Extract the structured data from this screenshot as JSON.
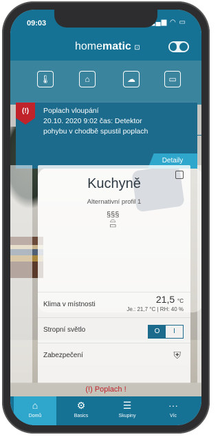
{
  "status": {
    "time": "09:03",
    "icons": "▂▄▆ ◠ ▭"
  },
  "header": {
    "brand_prefix": "home",
    "brand_suffix": "matic",
    "brand_mark": "⊡"
  },
  "quick_icons": [
    {
      "name": "thermometer-icon",
      "glyph": "🌡"
    },
    {
      "name": "home-icon",
      "glyph": "⌂"
    },
    {
      "name": "cloud-icon",
      "glyph": "☁"
    },
    {
      "name": "window-icon",
      "glyph": "▭"
    }
  ],
  "alarm": {
    "title": "Poplach vloupání",
    "line1": "20.10. 2020 9:02 čas: Detektor",
    "line2": "pohybu v chodbě spustil poplach",
    "details_label": "Detaily",
    "flag_glyph": "(!)"
  },
  "card": {
    "title": "Kuchyně",
    "subtitle": "Alternativní profil 1",
    "rows": {
      "climate_label": "Klima v místnosti",
      "climate_value": "21,5",
      "climate_unit": "°C",
      "climate_sub": "Je.: 21,7 °C | RH: 40 %",
      "light_label": "Stropní světlo",
      "light_on": "O",
      "light_off": "I",
      "security_label": "Zabezpečení"
    }
  },
  "alarm_bar": {
    "glyph": "(!)",
    "label": "Poplach !"
  },
  "tabs": [
    {
      "label": "Domů",
      "glyph": "⌂"
    },
    {
      "label": "Basics",
      "glyph": "⚙"
    },
    {
      "label": "Skupiny",
      "glyph": "☰"
    },
    {
      "label": "Víc",
      "glyph": "···"
    }
  ],
  "colors": {
    "primary": "#157294",
    "accent": "#2fa6cc",
    "alarm": "#c0242a"
  }
}
